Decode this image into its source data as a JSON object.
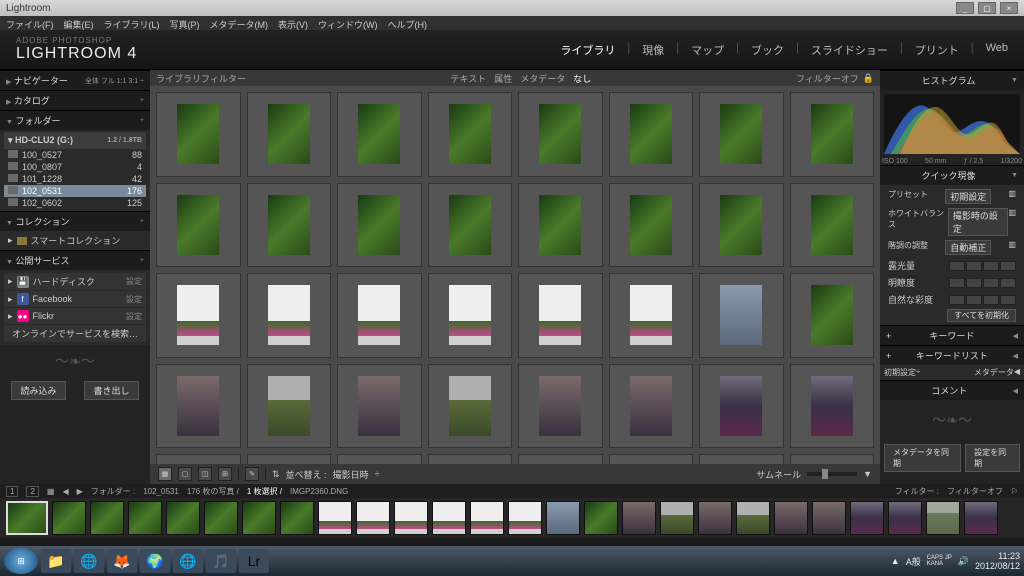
{
  "window": {
    "title": "Lightroom"
  },
  "menu": [
    "ファイル(F)",
    "編集(E)",
    "ライブラリ(L)",
    "写真(P)",
    "メタデータ(M)",
    "表示(V)",
    "ウィンドウ(W)",
    "ヘルプ(H)"
  ],
  "brand": {
    "top": "ADOBE PHOTOSHOP",
    "main": "LIGHTROOM 4"
  },
  "modules": [
    "ライブラリ",
    "現像",
    "マップ",
    "ブック",
    "スライドショー",
    "プリント",
    "Web"
  ],
  "active_module": "ライブラリ",
  "left": {
    "navigator": {
      "title": "ナビゲーター",
      "presets": [
        "全体",
        "フル",
        "1:1",
        "3:1"
      ]
    },
    "catalog": {
      "title": "カタログ"
    },
    "folders": {
      "title": "フォルダー",
      "volume": {
        "name": "HD-CLU2 (G:)",
        "stat": "1.2 / 1.8TB"
      },
      "items": [
        {
          "name": "100_0527",
          "count": "88"
        },
        {
          "name": "100_0807",
          "count": "4"
        },
        {
          "name": "101_1228",
          "count": "42"
        },
        {
          "name": "102_0531",
          "count": "176"
        },
        {
          "name": "102_0602",
          "count": "125"
        }
      ],
      "selected": 3
    },
    "collections": {
      "title": "コレクション",
      "item": "スマートコレクション"
    },
    "publish": {
      "title": "公開サービス",
      "services": [
        {
          "name": "ハードディスク",
          "icon": "💾",
          "bg": "#888",
          "setup": "設定"
        },
        {
          "name": "Facebook",
          "icon": "f",
          "bg": "#3b5998",
          "setup": "設定"
        },
        {
          "name": "Flickr",
          "icon": "●●",
          "bg": "#ff0084",
          "setup": "設定"
        }
      ],
      "find": "オンラインでサービスを検索…"
    },
    "buttons": {
      "import": "読み込み",
      "export": "書き出し"
    }
  },
  "filter": {
    "label": "ライブラリフィルター",
    "tabs": [
      "テキスト",
      "属性",
      "メタデータ",
      "なし"
    ],
    "active": "なし",
    "off_label": "フィルターオフ"
  },
  "toolbar": {
    "sort_label": "並べ替え :",
    "sort_by": "撮影日時",
    "thumb_label": "サムネール"
  },
  "right": {
    "histogram": {
      "title": "ヒストグラム",
      "iso": "ISO 100",
      "focal": "50 mm",
      "aperture": "ƒ / 2.5",
      "shutter": "1/3200"
    },
    "quick": {
      "title": "クイック現像",
      "preset_lbl": "プリセット",
      "preset_val": "初期設定",
      "wb_lbl": "ホワイトバランス",
      "wb_val": "撮影時の設定",
      "tone_lbl": "階調の調整",
      "tone_btn": "自動補正",
      "sliders": [
        "露光量",
        "明瞭度",
        "自然な彩度"
      ],
      "reset": "すべてを初期化"
    },
    "keywords": {
      "title": "キーワード"
    },
    "keyword_list": {
      "title": "キーワードリスト"
    },
    "metadata": {
      "title": "メタデータ",
      "preset_lbl": "初期設定"
    },
    "comments": {
      "title": "コメント"
    },
    "sync_buttons": {
      "meta": "メタデータを同期",
      "settings": "設定を同期"
    }
  },
  "secondary": {
    "folder_lbl": "フォルダー :",
    "folder_val": "102_0531",
    "count_lbl": "176 枚の写真 /",
    "sel_lbl": "1 枚選択 /",
    "file": "IMGP2360.DNG",
    "filter_lbl": "フィルター :",
    "filter_off": "フィルターオフ"
  },
  "taskbar": {
    "icons": [
      "📁",
      "🌐",
      "🦊",
      "🌍",
      "🌐",
      "🎵",
      "Lr"
    ],
    "time": "11:23",
    "date": "2012/08/12",
    "lang": "A般",
    "ime": "CAPS JP\nKANA"
  },
  "grid_thumbs": [
    "g-green",
    "g-green",
    "g-green",
    "g-green",
    "g-green",
    "g-green",
    "g-green",
    "g-green",
    "g-green",
    "g-green",
    "g-green",
    "g-green",
    "g-green",
    "g-green",
    "g-green",
    "g-green",
    "g-banner",
    "g-banner",
    "g-banner",
    "g-banner",
    "g-banner",
    "g-banner",
    "g-sky",
    "g-green",
    "g-dusk",
    "g-field",
    "g-dusk",
    "g-field",
    "g-dusk",
    "g-dusk",
    "g-purple",
    "g-purple",
    "g-pond",
    "g-purple",
    "g-pond",
    "g-purple",
    "g-purple",
    "g-purple",
    "g-night",
    "g-sign"
  ]
}
